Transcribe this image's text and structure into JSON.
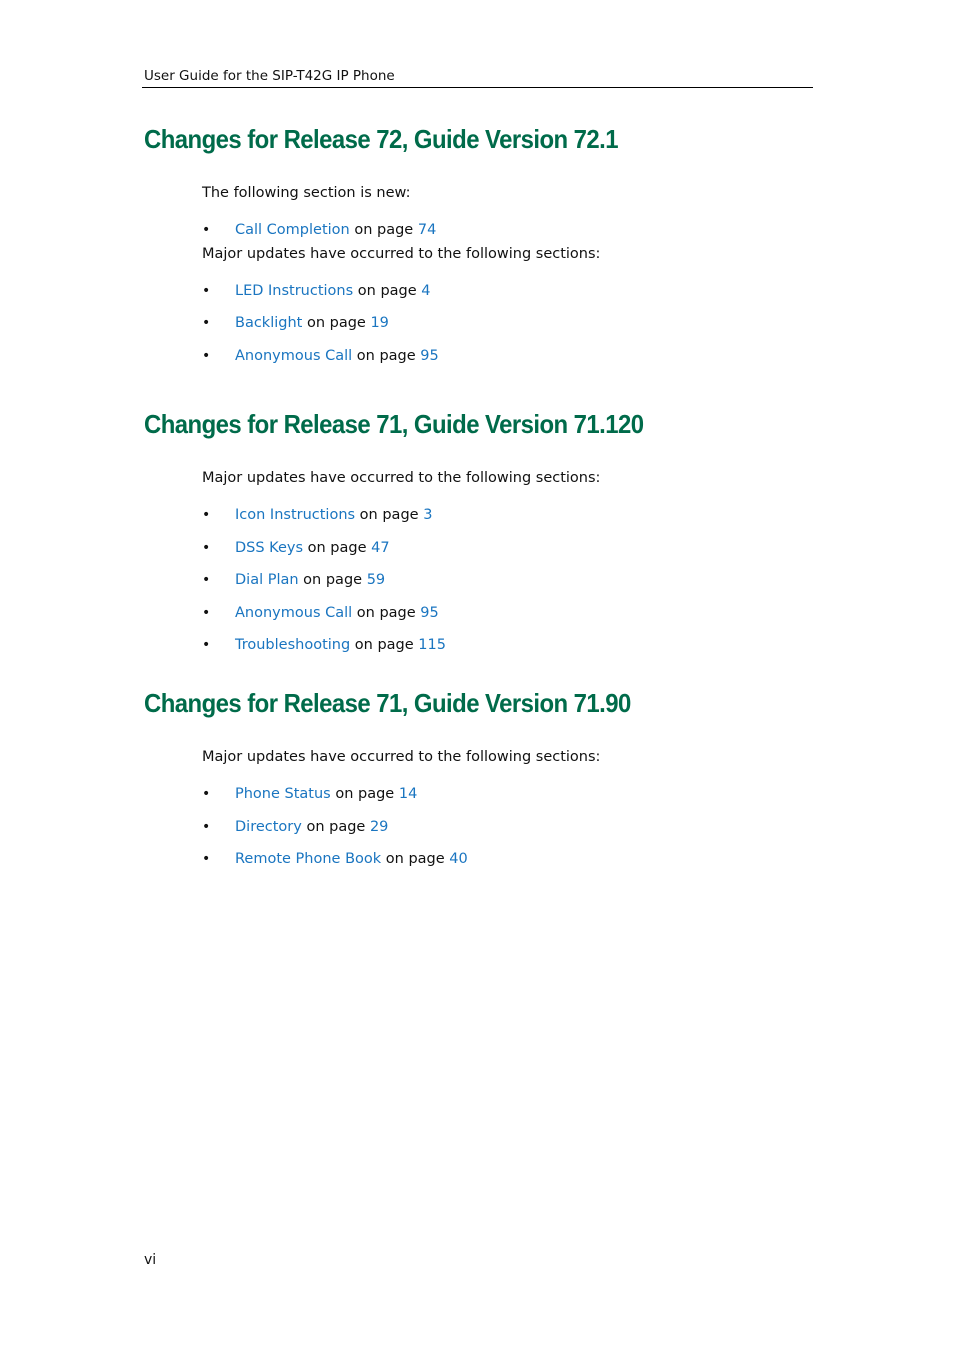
{
  "header": {
    "running_title": "User Guide for the SIP-T42G IP Phone"
  },
  "sections": [
    {
      "title": "Changes for Release 72, Guide Version 72.1",
      "blocks": [
        {
          "intro": "The following section is new:",
          "items": [
            {
              "link": "Call Completion",
              "mid": " on page ",
              "page": "74"
            }
          ]
        },
        {
          "intro": "Major updates have occurred to the following sections:",
          "items": [
            {
              "link": "LED Instructions",
              "mid": " on page ",
              "page": "4"
            },
            {
              "link": "Backlight",
              "mid": " on page ",
              "page": "19"
            },
            {
              "link": "Anonymous Call",
              "mid": " on page ",
              "page": "95"
            }
          ]
        }
      ]
    },
    {
      "title": "Changes for Release 71, Guide Version 71.120",
      "blocks": [
        {
          "intro": "Major updates have occurred to the following sections:",
          "items": [
            {
              "link": "Icon Instructions",
              "mid": " on page ",
              "page": "3"
            },
            {
              "link": "DSS Keys",
              "mid": " on page ",
              "page": "47"
            },
            {
              "link": "Dial Plan",
              "mid": " on page ",
              "page": "59"
            },
            {
              "link": "Anonymous Call",
              "mid": " on page ",
              "page": "95"
            },
            {
              "link": "Troubleshooting",
              "mid": " on page ",
              "page": "115"
            }
          ]
        }
      ]
    },
    {
      "title": "Changes for Release 71, Guide Version 71.90",
      "blocks": [
        {
          "intro": "Major updates have occurred to the following sections:",
          "items": [
            {
              "link": "Phone Status",
              "mid": " on page ",
              "page": "14"
            },
            {
              "link": "Directory",
              "mid": " on page ",
              "page": "29"
            },
            {
              "link": "Remote Phone Book",
              "mid": " on page ",
              "page": "40"
            }
          ]
        }
      ]
    }
  ],
  "bullet_glyph": "•",
  "footer": {
    "page_number": "vi"
  },
  "colors": {
    "heading": "#006b4a",
    "link": "#1a75c0",
    "text": "#111111"
  }
}
